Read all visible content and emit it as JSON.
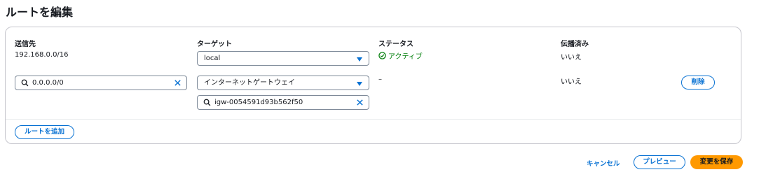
{
  "page": {
    "title": "ルートを編集"
  },
  "table": {
    "headers": {
      "destination": "送信先",
      "target": "ターゲット",
      "status": "ステータス",
      "propagated": "伝播済み"
    },
    "rows": [
      {
        "destination": "192.168.0.0/16",
        "target": "local",
        "status": "アクティブ",
        "propagated": "いいえ"
      },
      {
        "destination": "0.0.0.0/0",
        "target": "インターネットゲートウェイ",
        "target_id": "igw-0054591d93b562f50",
        "status": "–",
        "propagated": "いいえ",
        "remove_label": "削除"
      }
    ],
    "add_route_label": "ルートを追加"
  },
  "footer": {
    "cancel_label": "キャンセル",
    "preview_label": "プレビュー",
    "save_label": "変更を保存"
  },
  "colors": {
    "accent": "#0972d3",
    "primary_button": "#ff9900",
    "status_active": "#037f0c",
    "border": "#7d8998"
  },
  "icons": {
    "search": "search-icon",
    "clear": "close-icon",
    "status": "check-circle-icon",
    "dropdown": "caret-down-icon"
  }
}
